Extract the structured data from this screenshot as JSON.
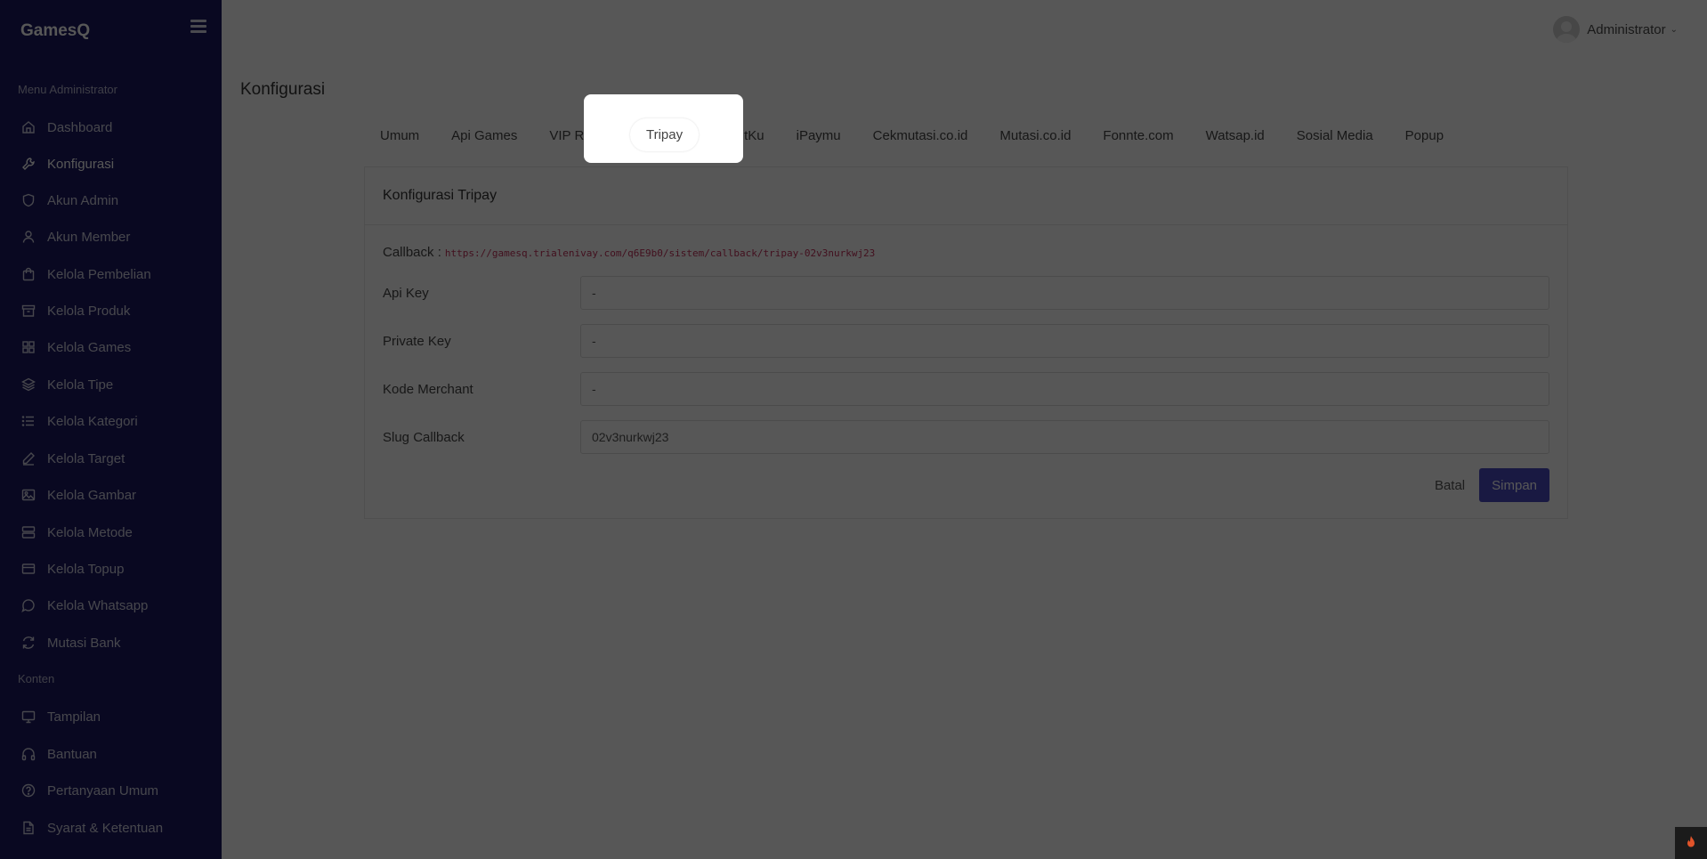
{
  "sidebar": {
    "brand": "GamesQ",
    "sections": [
      {
        "title": "Menu Administrator",
        "items": [
          {
            "label": "Dashboard",
            "icon": "home-icon"
          },
          {
            "label": "Konfigurasi",
            "icon": "wrench-icon",
            "active": true
          },
          {
            "label": "Akun Admin",
            "icon": "shield-icon"
          },
          {
            "label": "Akun Member",
            "icon": "user-icon"
          },
          {
            "label": "Kelola Pembelian",
            "icon": "shopping-bag-icon"
          },
          {
            "label": "Kelola Produk",
            "icon": "archive-icon"
          },
          {
            "label": "Kelola Games",
            "icon": "grid-icon"
          },
          {
            "label": "Kelola Tipe",
            "icon": "layers-icon"
          },
          {
            "label": "Kelola Kategori",
            "icon": "list-icon"
          },
          {
            "label": "Kelola Target",
            "icon": "pen-icon"
          },
          {
            "label": "Kelola Gambar",
            "icon": "image-icon"
          },
          {
            "label": "Kelola Metode",
            "icon": "server-icon"
          },
          {
            "label": "Kelola Topup",
            "icon": "credit-card-icon"
          },
          {
            "label": "Kelola Whatsapp",
            "icon": "chat-icon"
          },
          {
            "label": "Mutasi Bank",
            "icon": "refresh-icon"
          }
        ]
      },
      {
        "title": "Konten",
        "items": [
          {
            "label": "Tampilan",
            "icon": "monitor-icon"
          },
          {
            "label": "Bantuan",
            "icon": "headphones-icon"
          },
          {
            "label": "Pertanyaan Umum",
            "icon": "help-circle-icon"
          },
          {
            "label": "Syarat & Ketentuan",
            "icon": "file-text-icon"
          }
        ]
      }
    ]
  },
  "header": {
    "user_name": "Administrator"
  },
  "page": {
    "title": "Konfigurasi"
  },
  "tabs": [
    {
      "label": "Umum"
    },
    {
      "label": "Api Games"
    },
    {
      "label": "VIP Reseller"
    },
    {
      "label": "Tripay",
      "active": true
    },
    {
      "label": "DuitKu"
    },
    {
      "label": "iPaymu"
    },
    {
      "label": "Cekmutasi.co.id"
    },
    {
      "label": "Mutasi.co.id"
    },
    {
      "label": "Fonnte.com"
    },
    {
      "label": "Watsap.id"
    },
    {
      "label": "Sosial Media"
    },
    {
      "label": "Popup"
    }
  ],
  "card": {
    "title": "Konfigurasi Tripay",
    "callback_label": "Callback :",
    "callback_url": "https://gamesq.trialenivay.com/q6E9b0/sistem/callback/tripay-02v3nurkwj23",
    "fields": [
      {
        "label": "Api Key",
        "value": "-"
      },
      {
        "label": "Private Key",
        "value": "-"
      },
      {
        "label": "Kode Merchant",
        "value": "-"
      },
      {
        "label": "Slug Callback",
        "value": "02v3nurkwj23"
      }
    ],
    "cancel_label": "Batal",
    "save_label": "Simpan"
  },
  "colors": {
    "sidebar_bg": "#1b1960",
    "primary": "#4a4ac0",
    "callback_code": "#c0305a"
  }
}
